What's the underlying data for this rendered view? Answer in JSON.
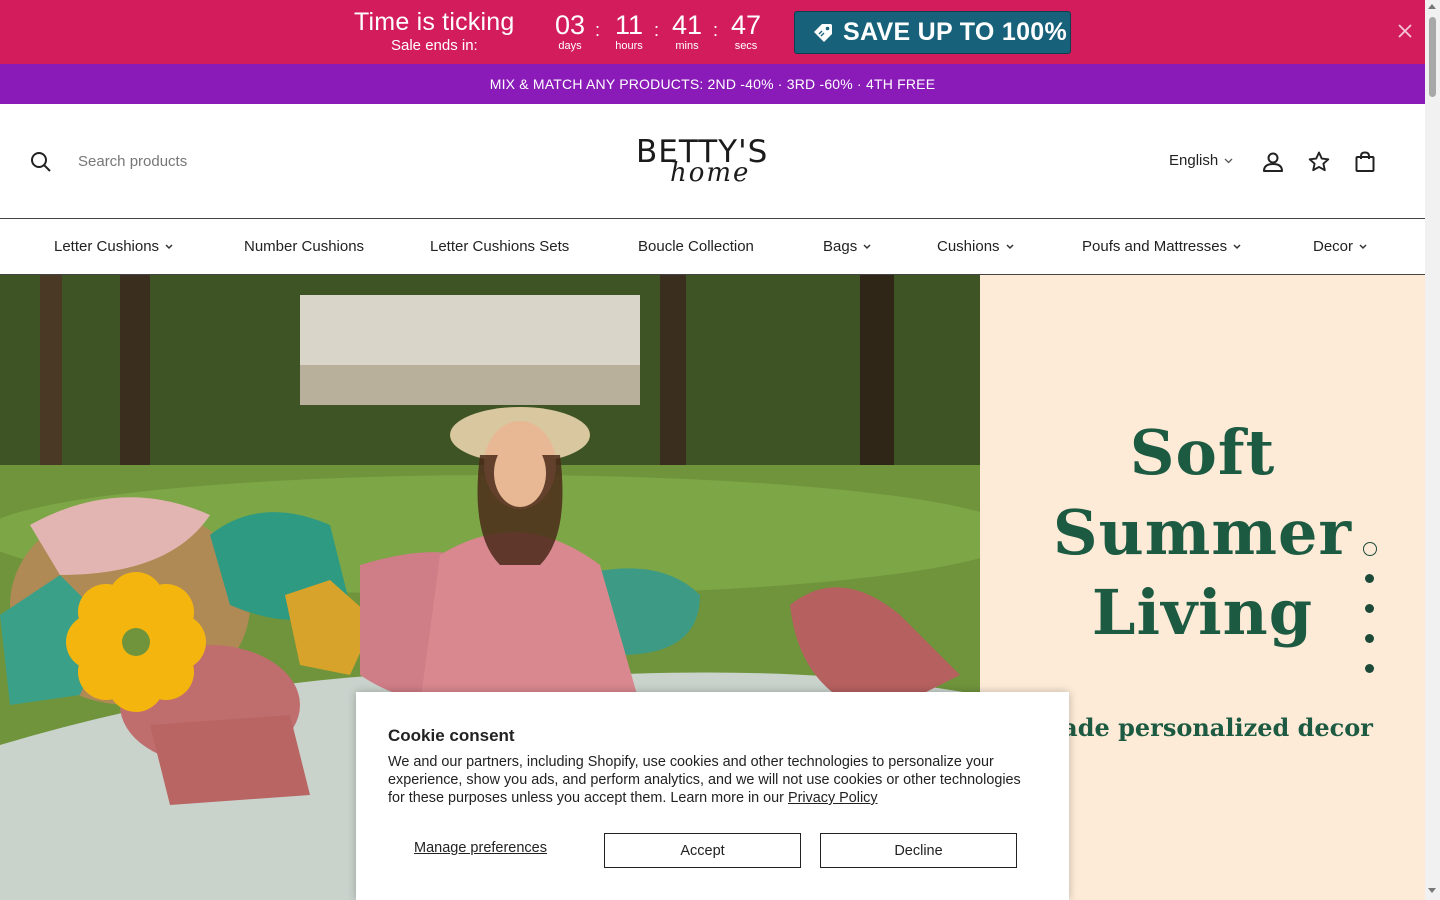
{
  "countdown": {
    "title": "Time is ticking",
    "subtitle": "Sale ends in:",
    "units": [
      {
        "value": "03",
        "label": "days"
      },
      {
        "value": "11",
        "label": "hours"
      },
      {
        "value": "41",
        "label": "mins"
      },
      {
        "value": "47",
        "label": "secs"
      }
    ],
    "separator": ":",
    "cta_label": "SAVE UP TO 100%",
    "close_icon": "close-icon",
    "bg_color": "#d31c5c",
    "cta_color": "#17627a"
  },
  "promo": {
    "text": "MIX & MATCH ANY PRODUCTS: 2ND -40% · 3RD -60% · 4TH FREE",
    "bg_color": "#8a1bb8"
  },
  "header": {
    "search_placeholder": "Search products",
    "logo_text": "BETTY'S",
    "logo_script": "home",
    "language": "English",
    "icons": [
      "account-icon",
      "wishlist-star-icon",
      "cart-bag-icon"
    ]
  },
  "nav": {
    "items": [
      {
        "label": "Letter Cushions",
        "has_dropdown": true
      },
      {
        "label": "Number Cushions",
        "has_dropdown": false
      },
      {
        "label": "Letter Cushions Sets",
        "has_dropdown": false
      },
      {
        "label": "Boucle Collection",
        "has_dropdown": false
      },
      {
        "label": "Bags",
        "has_dropdown": true
      },
      {
        "label": "Cushions",
        "has_dropdown": true
      },
      {
        "label": "Poufs and Mattresses",
        "has_dropdown": true
      },
      {
        "label": "Decor",
        "has_dropdown": true
      }
    ]
  },
  "hero": {
    "title_lines": [
      "Soft",
      "Summer",
      "Living"
    ],
    "subtitle": "dmade personalized decor",
    "slide_count": 5,
    "active_slide": 1,
    "accent_color": "#1d5a42",
    "panel_color": "#fdebd8"
  },
  "cookie": {
    "title": "Cookie consent",
    "body": "We and our partners, including Shopify, use cookies and other technologies to personalize your experience, show you ads, and perform analytics, and we will not use cookies or other technologies for these purposes unless you accept them. Learn more in our ",
    "link_text": "Privacy Policy",
    "manage_label": "Manage preferences",
    "accept_label": "Accept",
    "decline_label": "Decline"
  }
}
